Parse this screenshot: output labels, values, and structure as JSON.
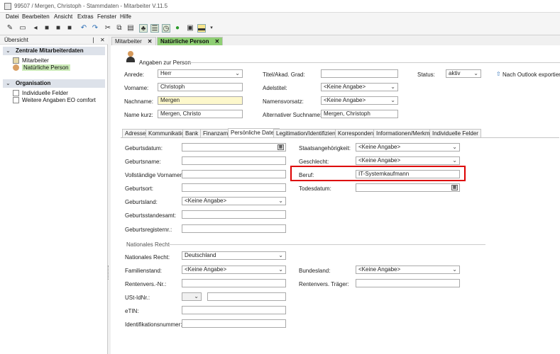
{
  "window": {
    "title": "99507 / Mergen, Christoph - Stammdaten - Mitarbeiter V.11.5"
  },
  "menu": [
    "Datei",
    "Bearbeiten",
    "Ansicht",
    "Extras",
    "Fenster",
    "Hilfe"
  ],
  "left": {
    "header": "Übersicht",
    "pin": "❘",
    "close": "✕",
    "groups": [
      {
        "label": "Zentrale Mitarbeiterdaten",
        "items": [
          "Mitarbeiter",
          "Natürliche Person"
        ]
      },
      {
        "label": "Organisation",
        "items": [
          "Individuelle Felder",
          "Weitere Angaben EO comfort"
        ]
      }
    ]
  },
  "doc_tabs": [
    {
      "label": "Mitarbeiter"
    },
    {
      "label": "Natürliche Person"
    }
  ],
  "section": {
    "title": "Angaben zur Person"
  },
  "person": {
    "anrede_label": "Anrede:",
    "anrede": "Herr",
    "titel_label": "Titel/Akad. Grad:",
    "titel": "",
    "status_label": "Status:",
    "status": "aktiv",
    "outlook": "Nach Outlook exportieren",
    "vorname_label": "Vorname:",
    "vorname": "Christoph",
    "adel_label": "Adelstitel:",
    "adel": "<Keine Angabe>",
    "nachname_label": "Nachname:",
    "nachname": "Mergen",
    "namensvorsatz_label": "Namensvorsatz:",
    "namensvorsatz": "<Keine Angabe>",
    "kurz_label": "Name kurz:",
    "kurz": "Mergen, Christo",
    "suchname_label": "Alternativer Suchname:",
    "suchname": "Mergen, Christoph"
  },
  "inner_tabs": [
    "Adresse",
    "Kommunikation",
    "Bank",
    "Finanzamt",
    "Persönliche Daten",
    "Legitimation/Identifizierung",
    "Korrespondenz",
    "Informationen/Merkmale",
    "Individuelle Felder"
  ],
  "pers": {
    "geburtsdatum_label": "Geburtsdatum:",
    "geburtsdatum": "",
    "geburtsname_label": "Geburtsname:",
    "geburtsname": "",
    "vornamen_label": "Vollständige Vornamen:",
    "vornamen": "",
    "geburtsort_label": "Geburtsort:",
    "geburtsort": "",
    "geburtsland_label": "Geburtsland:",
    "geburtsland": "<Keine Angabe>",
    "standesamt_label": "Geburtsstandesamt:",
    "standesamt": "",
    "register_label": "Geburtsregisternr.:",
    "register": "",
    "staat_label": "Staatsangehörigkeit:",
    "staat": "<Keine Angabe>",
    "geschlecht_label": "Geschlecht:",
    "geschlecht": "<Keine Angabe>",
    "beruf_label": "Beruf:",
    "beruf": "IT-Systemkaufmann",
    "todesdatum_label": "Todesdatum:",
    "todesdatum": ""
  },
  "nat": {
    "group": "Nationales Recht",
    "recht_label": "Nationales Recht:",
    "recht": "Deutschland",
    "familienstand_label": "Familienstand:",
    "familienstand": "<Keine Angabe>",
    "bundesland_label": "Bundesland:",
    "bundesland": "<Keine Angabe>",
    "rv_nr_label": "Rentenvers.-Nr.:",
    "rv_nr": "",
    "rv_traeger_label": "Rentenvers. Träger:",
    "rv_traeger": "",
    "ust_label": "USt-IdNr.:",
    "ust": "",
    "etin_label": "eTIN:",
    "etin": "",
    "idnr_label": "Identifikationsnummer:",
    "idnr": ""
  },
  "colors": {
    "active_tab": "#8fcf74",
    "highlight": "#dd0000",
    "yellow_field": "#fdf8cc"
  }
}
